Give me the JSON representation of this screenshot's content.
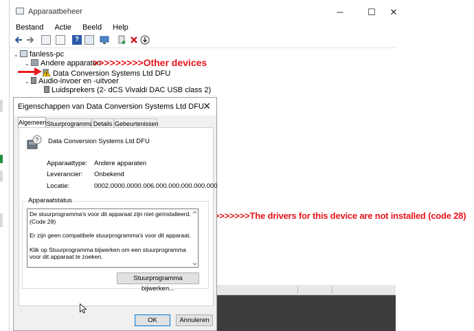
{
  "window": {
    "title": "Apparaatbeheer",
    "minimize": "─",
    "maximize": "☐",
    "close": "✕"
  },
  "menu": [
    "Bestand",
    "Actie",
    "Beeld",
    "Help"
  ],
  "toolbar_icons": [
    "back-icon",
    "forward-icon",
    "properties-icon",
    "driver-icon",
    "help-icon",
    "view-icon",
    "monitor-icon",
    "add-driver-icon",
    "uninstall-icon",
    "update-icon"
  ],
  "tree": {
    "root": "fanless-pc",
    "other_devices": "Andere apparaten",
    "other_device_item": "Data Conversion Systems Ltd DFU",
    "audio": "Audio-invoer en -uitvoer",
    "audio_item": "Luidsprekers (2- dCS Vivaldi DAC USB class 2)"
  },
  "annotations": {
    "other_devices": ">>>>>>>>>Other devices",
    "drivers": ">>>>>>>>>The drivers for this device are not installed (code 28)",
    "color": "#e8161d"
  },
  "dialog": {
    "title": "Eigenschappen van Data Conversion Systems Ltd DFU",
    "close": "✕",
    "tabs": [
      "Algemeen",
      "Stuurprogramma",
      "Details",
      "Gebeurtenissen"
    ],
    "device_name": "Data Conversion Systems Ltd DFU",
    "properties": [
      {
        "label": "Apparaattype:",
        "value": "Andere apparaten"
      },
      {
        "label": "Leverancier:",
        "value": "Onbekend"
      },
      {
        "label": "Locatie:",
        "value": "0002.0000.0000.006.000.000.000.000.000"
      }
    ],
    "status_group": "Apparaatstatus",
    "status_lines": [
      "De stuurprogramma's voor dit apparaat zijn niet geïnstalleerd. (Code 28)",
      "Er zijn geen compatibele stuurprogramma's voor dit apparaat.",
      "Klik op Stuurprogramma bijwerken om een stuurprogramma voor dit apparaat te zoeken."
    ],
    "update_button": "Stuurprogramma bijwerken...",
    "ok_button": "OK",
    "cancel_button": "Annuleren"
  }
}
